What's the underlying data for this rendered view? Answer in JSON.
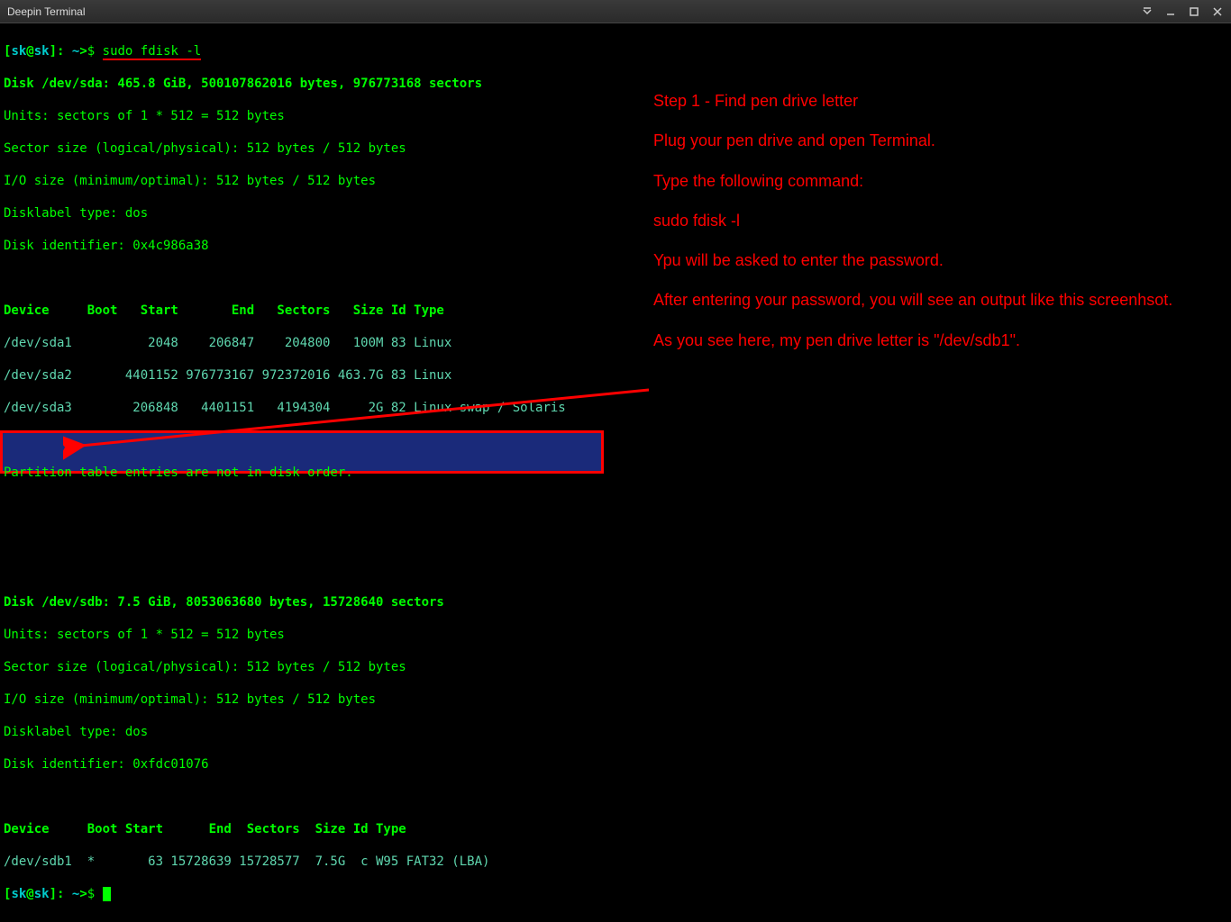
{
  "window": {
    "title": "Deepin Terminal"
  },
  "prompt": {
    "user": "sk",
    "host": "sk",
    "path": "~",
    "symbol": "$"
  },
  "command": "sudo fdisk -l",
  "output": {
    "sda_header": "Disk /dev/sda: 465.8 GiB, 500107862016 bytes, 976773168 sectors",
    "sda_units": "Units: sectors of 1 * 512 = 512 bytes",
    "sda_sector": "Sector size (logical/physical): 512 bytes / 512 bytes",
    "sda_io": "I/O size (minimum/optimal): 512 bytes / 512 bytes",
    "sda_label": "Disklabel type: dos",
    "sda_id": "Disk identifier: 0x4c986a38",
    "sda_table_header": "Device     Boot   Start       End   Sectors   Size Id Type",
    "sda_rows": [
      "/dev/sda1          2048    206847    204800   100M 83 Linux",
      "/dev/sda2       4401152 976773167 972372016 463.7G 83 Linux",
      "/dev/sda3        206848   4401151   4194304     2G 82 Linux swap / Solaris"
    ],
    "sda_note": "Partition table entries are not in disk order.",
    "sdb_header": "Disk /dev/sdb: 7.5 GiB, 8053063680 bytes, 15728640 sectors",
    "sdb_units": "Units: sectors of 1 * 512 = 512 bytes",
    "sdb_sector": "Sector size (logical/physical): 512 bytes / 512 bytes",
    "sdb_io": "I/O size (minimum/optimal): 512 bytes / 512 bytes",
    "sdb_label": "Disklabel type: dos",
    "sdb_id": "Disk identifier: 0xfdc01076",
    "sdb_table_header": "Device     Boot Start      End  Sectors  Size Id Type",
    "sdb_rows": [
      "/dev/sdb1  *       63 15728639 15728577  7.5G  c W95 FAT32 (LBA)"
    ]
  },
  "annotations": {
    "line1": "Step 1 - Find pen drive letter",
    "line2": "Plug your pen drive and open Terminal.",
    "line3": "Type the following command:",
    "line4": "sudo fdisk -l",
    "line5": "Ypu will be asked to enter the password.",
    "line6": "After entering your password, you will see an output like this screenhsot.",
    "line7": "As you see here, my pen drive letter is \"/dev/sdb1\"."
  }
}
